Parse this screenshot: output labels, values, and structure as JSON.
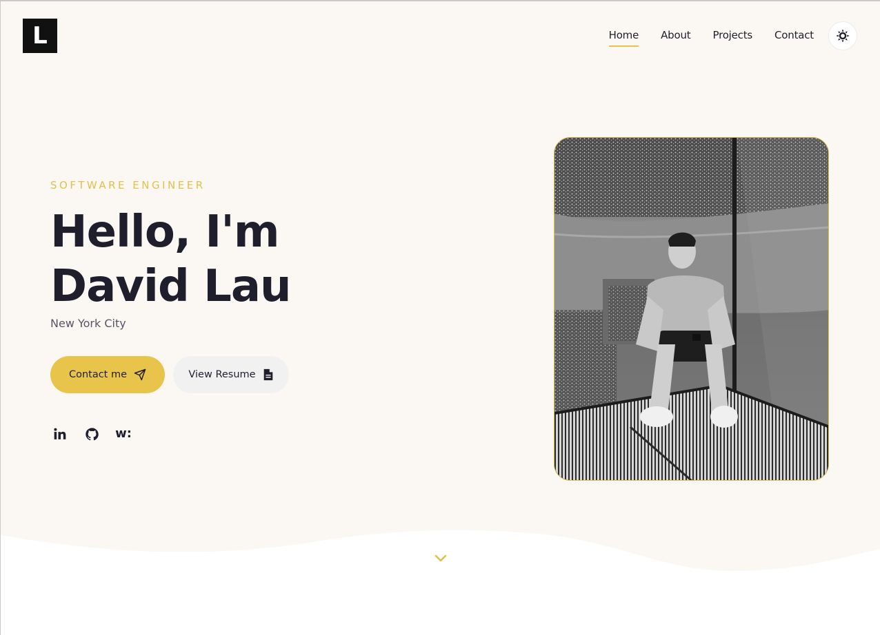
{
  "header": {
    "logo_letter": "L",
    "nav": [
      {
        "label": "Home",
        "active": true
      },
      {
        "label": "About",
        "active": false
      },
      {
        "label": "Projects",
        "active": false
      },
      {
        "label": "Contact",
        "active": false
      }
    ],
    "theme_toggle_icon": "sun-icon"
  },
  "hero": {
    "eyebrow": "SOFTWARE ENGINEER",
    "headline_line1": "Hello, I'm",
    "headline_line2": "David Lau",
    "location": "New York City",
    "buttons": {
      "contact_label": "Contact me",
      "contact_icon": "send-icon",
      "resume_label": "View Resume",
      "resume_icon": "document-icon"
    },
    "socials": [
      {
        "icon": "linkedin-icon"
      },
      {
        "icon": "github-icon"
      },
      {
        "icon": "wellfound-icon",
        "text": "w:"
      }
    ],
    "photo_icon": "portrait-photo"
  },
  "scroll_icon": "chevron-down-icon",
  "colors": {
    "accent": "#e8c44a",
    "hero_background": "#fbf8f4",
    "text": "#1e1e2c",
    "muted_text": "#555566",
    "secondary_button": "#f2f1f1"
  }
}
